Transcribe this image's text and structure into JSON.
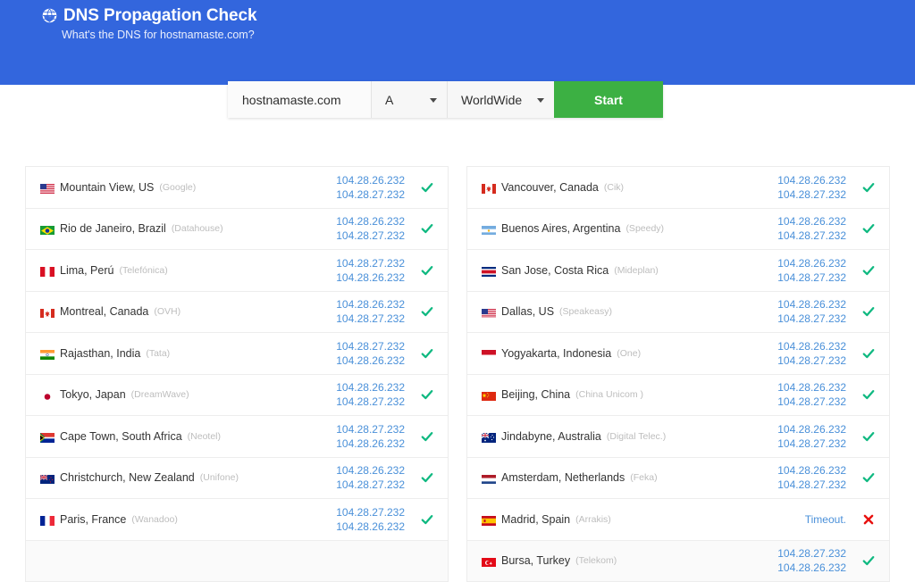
{
  "header": {
    "title": "DNS Propagation Check",
    "subtitle": "What's the DNS for hostnamaste.com?",
    "globe_icon": "globe-icon",
    "background_color": "#3366dd"
  },
  "search": {
    "domain_value": "hostnamaste.com",
    "domain_placeholder": "hostnamaste.com",
    "record_type": "A",
    "region": "WorldWide",
    "start_label": "Start",
    "start_color": "#3cb043"
  },
  "colors": {
    "ip_link": "#4a90d9",
    "success": "#10b981",
    "failure": "#e8110f",
    "isp_label": "#bdbdbd"
  },
  "status_icons": {
    "ok": "check-icon",
    "fail": "cross-icon"
  },
  "results": {
    "left_column": [
      {
        "location": "Mountain View, US",
        "isp": "(Google)",
        "flag": "us",
        "ips": [
          "104.28.26.232",
          "104.28.27.232"
        ],
        "status": "ok"
      },
      {
        "location": "Rio de Janeiro, Brazil",
        "isp": "(Datahouse)",
        "flag": "br",
        "ips": [
          "104.28.26.232",
          "104.28.27.232"
        ],
        "status": "ok"
      },
      {
        "location": "Lima, Perú",
        "isp": "(Telefónica)",
        "flag": "pe",
        "ips": [
          "104.28.27.232",
          "104.28.26.232"
        ],
        "status": "ok"
      },
      {
        "location": "Montreal, Canada",
        "isp": "(OVH)",
        "flag": "ca",
        "ips": [
          "104.28.26.232",
          "104.28.27.232"
        ],
        "status": "ok"
      },
      {
        "location": "Rajasthan, India",
        "isp": "(Tata)",
        "flag": "in",
        "ips": [
          "104.28.27.232",
          "104.28.26.232"
        ],
        "status": "ok"
      },
      {
        "location": "Tokyo, Japan",
        "isp": "(DreamWave)",
        "flag": "jp",
        "ips": [
          "104.28.26.232",
          "104.28.27.232"
        ],
        "status": "ok"
      },
      {
        "location": "Cape Town, South Africa",
        "isp": "(Neotel)",
        "flag": "za",
        "ips": [
          "104.28.27.232",
          "104.28.26.232"
        ],
        "status": "ok"
      },
      {
        "location": "Christchurch, New Zealand",
        "isp": "(Unifone)",
        "flag": "nz",
        "ips": [
          "104.28.26.232",
          "104.28.27.232"
        ],
        "status": "ok"
      },
      {
        "location": "Paris, France",
        "isp": "(Wanadoo)",
        "flag": "fr",
        "ips": [
          "104.28.27.232",
          "104.28.26.232"
        ],
        "status": "ok"
      }
    ],
    "right_column": [
      {
        "location": "Vancouver, Canada",
        "isp": "(Cik)",
        "flag": "ca",
        "ips": [
          "104.28.26.232",
          "104.28.27.232"
        ],
        "status": "ok"
      },
      {
        "location": "Buenos Aires, Argentina",
        "isp": "(Speedy)",
        "flag": "ar",
        "ips": [
          "104.28.26.232",
          "104.28.27.232"
        ],
        "status": "ok"
      },
      {
        "location": "San Jose, Costa Rica",
        "isp": "(Mideplan)",
        "flag": "cr",
        "ips": [
          "104.28.26.232",
          "104.28.27.232"
        ],
        "status": "ok"
      },
      {
        "location": "Dallas, US",
        "isp": "(Speakeasy)",
        "flag": "us",
        "ips": [
          "104.28.26.232",
          "104.28.27.232"
        ],
        "status": "ok"
      },
      {
        "location": "Yogyakarta, Indonesia",
        "isp": "(One)",
        "flag": "id",
        "ips": [
          "104.28.26.232",
          "104.28.27.232"
        ],
        "status": "ok"
      },
      {
        "location": "Beijing, China",
        "isp": "(China Unicom )",
        "flag": "cn",
        "ips": [
          "104.28.26.232",
          "104.28.27.232"
        ],
        "status": "ok"
      },
      {
        "location": "Jindabyne, Australia",
        "isp": "(Digital Telec.)",
        "flag": "au",
        "ips": [
          "104.28.26.232",
          "104.28.27.232"
        ],
        "status": "ok"
      },
      {
        "location": "Amsterdam, Netherlands",
        "isp": "(Feka)",
        "flag": "nl",
        "ips": [
          "104.28.26.232",
          "104.28.27.232"
        ],
        "status": "ok"
      },
      {
        "location": "Madrid, Spain",
        "isp": "(Arrakis)",
        "flag": "es",
        "ips": [
          "Timeout."
        ],
        "status": "fail"
      },
      {
        "location": "Bursa, Turkey",
        "isp": "(Telekom)",
        "flag": "tr",
        "ips": [
          "104.28.27.232",
          "104.28.26.232"
        ],
        "status": "ok",
        "shaded": true
      }
    ]
  }
}
